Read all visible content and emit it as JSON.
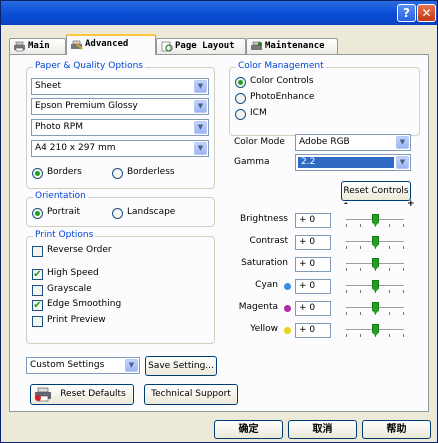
{
  "titlebar": {
    "help_label": "?",
    "close_label": "✕"
  },
  "tabs": [
    {
      "label": "Main",
      "icon": "printer-icon"
    },
    {
      "label": "Advanced",
      "icon": "wrench-icon"
    },
    {
      "label": "Page Layout",
      "icon": "page-layout-icon"
    },
    {
      "label": "Maintenance",
      "icon": "maintenance-icon"
    }
  ],
  "paper": {
    "group_label": "Paper & Quality Options",
    "source": "Sheet",
    "type": "Epson Premium Glossy",
    "quality": "Photo RPM",
    "size": "A4 210 x 297 mm",
    "borders_label": "Borders",
    "borderless_label": "Borderless"
  },
  "orientation": {
    "group_label": "Orientation",
    "portrait_label": "Portrait",
    "landscape_label": "Landscape"
  },
  "print_options": {
    "group_label": "Print Options",
    "items": [
      {
        "label": "Reverse Order",
        "checked": false
      },
      {
        "label": "High Speed",
        "checked": true
      },
      {
        "label": "Grayscale",
        "checked": false
      },
      {
        "label": "Edge Smoothing",
        "checked": true
      },
      {
        "label": "Print Preview",
        "checked": false
      }
    ]
  },
  "settings": {
    "preset": "Custom Settings",
    "save_label": "Save Setting...",
    "reset_label": "Reset Defaults",
    "support_label": "Technical Support"
  },
  "color": {
    "group_label": "Color Management",
    "color_controls_label": "Color Controls",
    "photoenhance_label": "PhotoEnhance",
    "icm_label": "ICM",
    "mode_label": "Color Mode",
    "mode_value": "Adobe RGB",
    "gamma_label": "Gamma",
    "gamma_value": "2.2",
    "reset_controls_label": "Reset Controls",
    "minus": "-",
    "plus": "+",
    "sliders": [
      {
        "label": "Brightness",
        "value": "+ 0",
        "dot": ""
      },
      {
        "label": "Contrast",
        "value": "+ 0",
        "dot": ""
      },
      {
        "label": "Saturation",
        "value": "+ 0",
        "dot": ""
      },
      {
        "label": "Cyan",
        "value": "+ 0",
        "dot": "#3a8de0"
      },
      {
        "label": "Magenta",
        "value": "+ 0",
        "dot": "#b02aa6"
      },
      {
        "label": "Yellow",
        "value": "+ 0",
        "dot": "#e8d21a"
      }
    ]
  },
  "footer": {
    "ok_label": "确定",
    "cancel_label": "取消",
    "help_label": "帮助"
  }
}
